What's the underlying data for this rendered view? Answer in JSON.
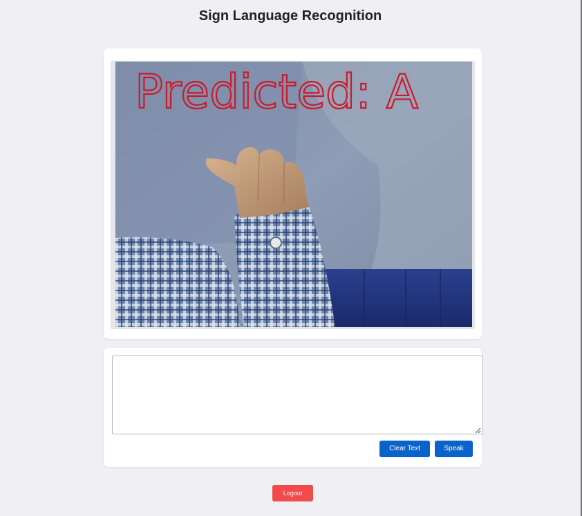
{
  "page": {
    "title": "Sign Language Recognition"
  },
  "video": {
    "overlay_text": "Predicted: A"
  },
  "input": {
    "text": "",
    "placeholder": ""
  },
  "actions": {
    "clear_label": "Clear Text",
    "speak_label": "Speak"
  },
  "footer": {
    "logout_label": "Logout"
  },
  "colors": {
    "background": "#f0f0f4",
    "primary_button": "#0a63c9",
    "logout_button": "#f24b4b",
    "prediction_text": "#cc1a2b"
  }
}
